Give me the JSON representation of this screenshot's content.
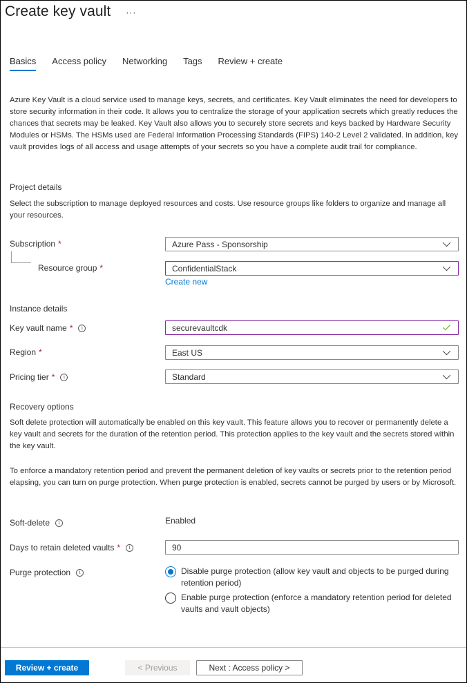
{
  "header": {
    "title": "Create key vault",
    "more_label": "···"
  },
  "tabs": [
    {
      "label": "Basics",
      "active": true
    },
    {
      "label": "Access policy",
      "active": false
    },
    {
      "label": "Networking",
      "active": false
    },
    {
      "label": "Tags",
      "active": false
    },
    {
      "label": "Review + create",
      "active": false
    }
  ],
  "intro": "Azure Key Vault is a cloud service used to manage keys, secrets, and certificates. Key Vault eliminates the need for developers to store security information in their code. It allows you to centralize the storage of your application secrets which greatly reduces the chances that secrets may be leaked. Key Vault also allows you to securely store secrets and keys backed by Hardware Security Modules or HSMs. The HSMs used are Federal Information Processing Standards (FIPS) 140-2 Level 2 validated. In addition, key vault provides logs of all access and usage attempts of your secrets so you have a complete audit trail for compliance.",
  "project_details": {
    "title": "Project details",
    "description": "Select the subscription to manage deployed resources and costs. Use resource groups like folders to organize and manage all your resources.",
    "subscription": {
      "label": "Subscription",
      "required": "*",
      "value": "Azure Pass - Sponsorship"
    },
    "resource_group": {
      "label": "Resource group",
      "required": "*",
      "value": "ConfidentialStack",
      "create_new": "Create new"
    }
  },
  "instance_details": {
    "title": "Instance details",
    "key_vault_name": {
      "label": "Key vault name",
      "required": "*",
      "value": "securevaultcdk",
      "valid": true
    },
    "region": {
      "label": "Region",
      "required": "*",
      "value": "East US"
    },
    "pricing_tier": {
      "label": "Pricing tier",
      "required": "*",
      "value": "Standard"
    }
  },
  "recovery_options": {
    "title": "Recovery options",
    "description1": "Soft delete protection will automatically be enabled on this key vault. This feature allows you to recover or permanently delete a key vault and secrets for the duration of the retention period. This protection applies to the key vault and the secrets stored within the key vault.",
    "description2": "To enforce a mandatory retention period and prevent the permanent deletion of key vaults or secrets prior to the retention period elapsing, you can turn on purge protection. When purge protection is enabled, secrets cannot be purged by users or by Microsoft.",
    "soft_delete": {
      "label": "Soft-delete",
      "value": "Enabled"
    },
    "days_to_retain": {
      "label": "Days to retain deleted vaults",
      "required": "*",
      "value": "90"
    },
    "purge_protection": {
      "label": "Purge protection",
      "options": [
        {
          "label": "Disable purge protection (allow key vault and objects to be purged during retention period)",
          "selected": true
        },
        {
          "label": "Enable purge protection (enforce a mandatory retention period for deleted vaults and vault objects)",
          "selected": false
        }
      ]
    }
  },
  "footer": {
    "review_create": "Review + create",
    "previous": "< Previous",
    "next": "Next : Access policy >"
  },
  "colors": {
    "accent": "#0078d4",
    "focus_border": "#8a2da5",
    "required": "#a4262c",
    "valid_check": "#57a300"
  }
}
